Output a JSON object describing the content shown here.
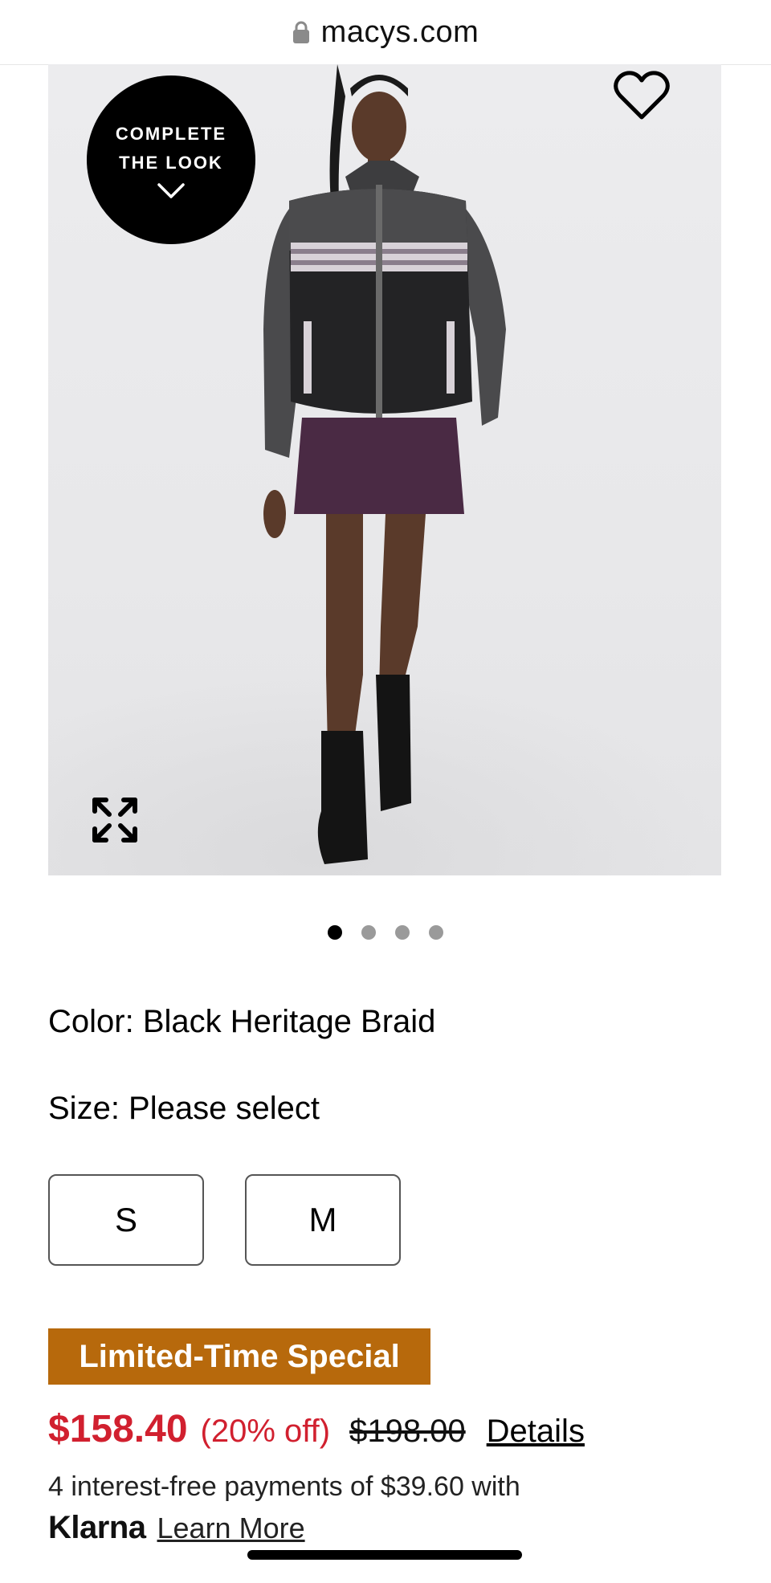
{
  "browser": {
    "url": "macys.com"
  },
  "hero": {
    "complete_look_label": "COMPLETE THE LOOK",
    "heart_icon": "heart-outline-icon",
    "expand_icon": "expand-arrows-icon"
  },
  "carousel": {
    "total_dots": 4,
    "active_index": 0
  },
  "product": {
    "color_text": "Color: Black Heritage Braid",
    "size_prompt": "Size: Please select",
    "sizes": [
      "S",
      "M"
    ],
    "badge": "Limited-Time Special",
    "sale_price": "$158.40",
    "discount": "(20% off)",
    "original_price": "$198.00",
    "details_link": "Details",
    "installments": "4 interest-free payments of $39.60 with",
    "klarna_logo": "Klarna",
    "learn_more": "Learn More"
  },
  "colors": {
    "sale_red": "#d1202f",
    "badge_orange": "#b7690c"
  }
}
